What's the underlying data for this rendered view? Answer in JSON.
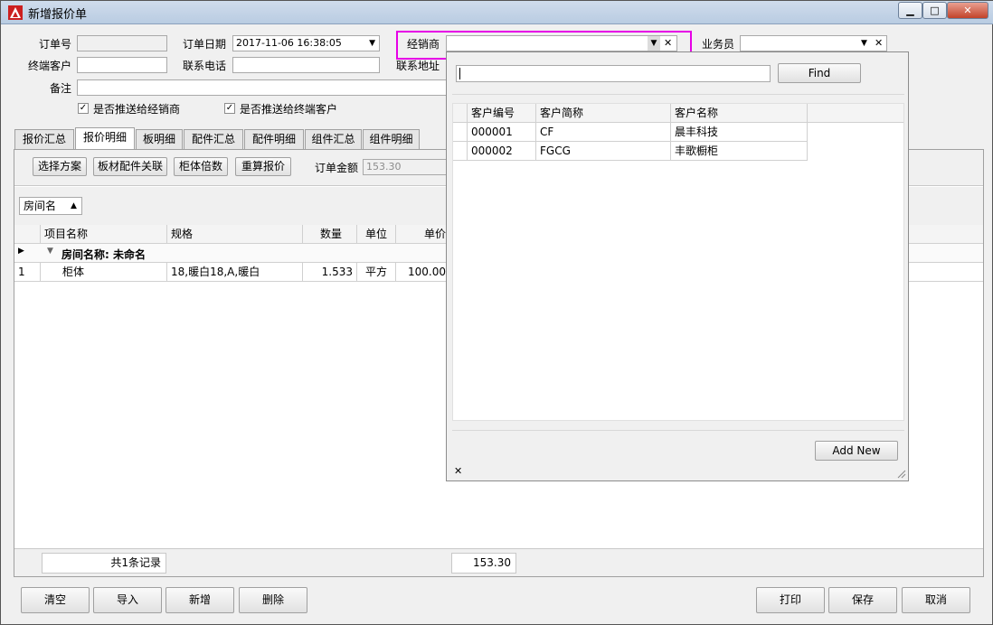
{
  "window": {
    "title": "新增报价单",
    "minimize": "▁",
    "maximize": "□",
    "close": "✕"
  },
  "form": {
    "order_no_label": "订单号",
    "order_no_value": "",
    "order_date_label": "订单日期",
    "order_date_value": "2017-11-06 16:38:05",
    "dealer_label": "经销商",
    "dealer_value": "",
    "salesman_label": "业务员",
    "salesman_value": "",
    "end_customer_label": "终端客户",
    "end_customer_value": "",
    "phone_label": "联系电话",
    "phone_value": "",
    "address_label": "联系地址",
    "remark_label": "备注",
    "remark_value": "",
    "push_dealer_label": "是否推送给经销商",
    "push_dealer_checked": true,
    "push_customer_label": "是否推送给终端客户",
    "push_customer_checked": true
  },
  "tabs": [
    "报价汇总",
    "报价明细",
    "板明细",
    "配件汇总",
    "配件明细",
    "组件汇总",
    "组件明细"
  ],
  "toolbar": {
    "select_plan": "选择方案",
    "panel_link": "板材配件关联",
    "cabinet_multiple": "柜体倍数",
    "recalc": "重算报价",
    "order_amount_label": "订单金额",
    "order_amount_value": "153.30"
  },
  "group_by": {
    "label": "房间名",
    "arrow": "▲"
  },
  "grid": {
    "columns": [
      "项目名称",
      "规格",
      "数量",
      "单位",
      "单价"
    ],
    "group_row": "房间名称: 未命名",
    "rows": [
      {
        "index": "1",
        "name": "柜体",
        "spec": "18,暖白18,A,暖白",
        "qty": "1.533",
        "unit": "平方",
        "price": "100.00"
      }
    ],
    "footer_count": "共1条记录",
    "footer_total": "153.30"
  },
  "popup": {
    "search_value": "",
    "find_label": "Find",
    "columns": [
      "客户编号",
      "客户简称",
      "客户名称"
    ],
    "rows": [
      {
        "code": "000001",
        "short": "CF",
        "name": "晨丰科技"
      },
      {
        "code": "000002",
        "short": "FGCG",
        "name": "丰歌橱柜"
      }
    ],
    "add_new_label": "Add New",
    "close_glyph": "✕"
  },
  "bottom_buttons": {
    "clear": "清空",
    "import": "导入",
    "add": "新增",
    "delete": "删除",
    "print": "打印",
    "save": "保存",
    "cancel": "取消"
  },
  "colors": {
    "highlight": "#e600e6",
    "title_icon": "#cc1f1f"
  }
}
